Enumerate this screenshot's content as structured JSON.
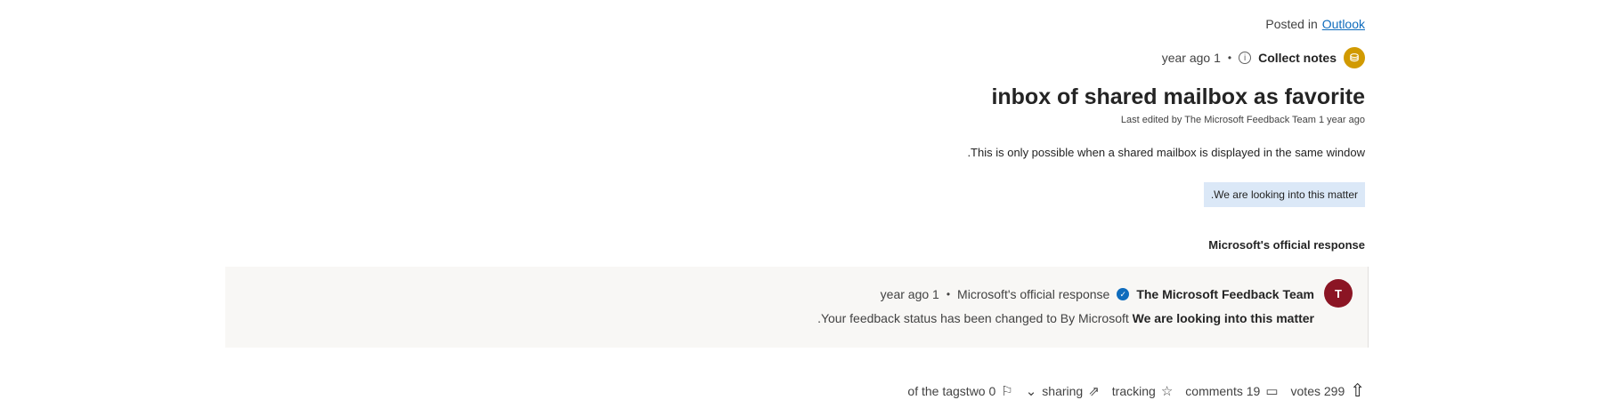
{
  "post": {
    "posted_label": "Posted in",
    "category": "Outlook",
    "time_ago": "year ago 1",
    "collect_notes": "Collect notes",
    "title": "inbox of shared mailbox as favorite",
    "edited": "Last edited by The Microsoft Feedback Team 1 year ago",
    "body": ".This is only possible when a shared mailbox is displayed in the same window",
    "status_badge": ".We are looking into this matter"
  },
  "official": {
    "heading": "Microsoft's official response",
    "time_ago": "year ago 1",
    "label": "Microsoft's official response",
    "author": "The Microsoft Feedback Team",
    "avatar_letter": "T",
    "text_prefix": ".Your feedback status has been changed to By Microsoft ",
    "status": "We are looking into this matter",
    "avatar_color": "#8b1524"
  },
  "toolbar": {
    "tags": "of the tagstwo 0",
    "sharing": "sharing",
    "tracking": "tracking",
    "comments": "comments 19",
    "votes": "votes 299"
  },
  "icons": {
    "info": "info-icon",
    "coin": "coin-icon",
    "verified": "verified-icon",
    "flag": "flag-icon",
    "chevron": "chevron-down-icon",
    "share": "share-icon",
    "star": "star-icon",
    "comment": "comment-icon",
    "upvote": "upvote-icon"
  },
  "colors": {
    "link": "#0f6cbd",
    "badge_bg": "#dbe8f7",
    "coin": "#d19a00"
  }
}
